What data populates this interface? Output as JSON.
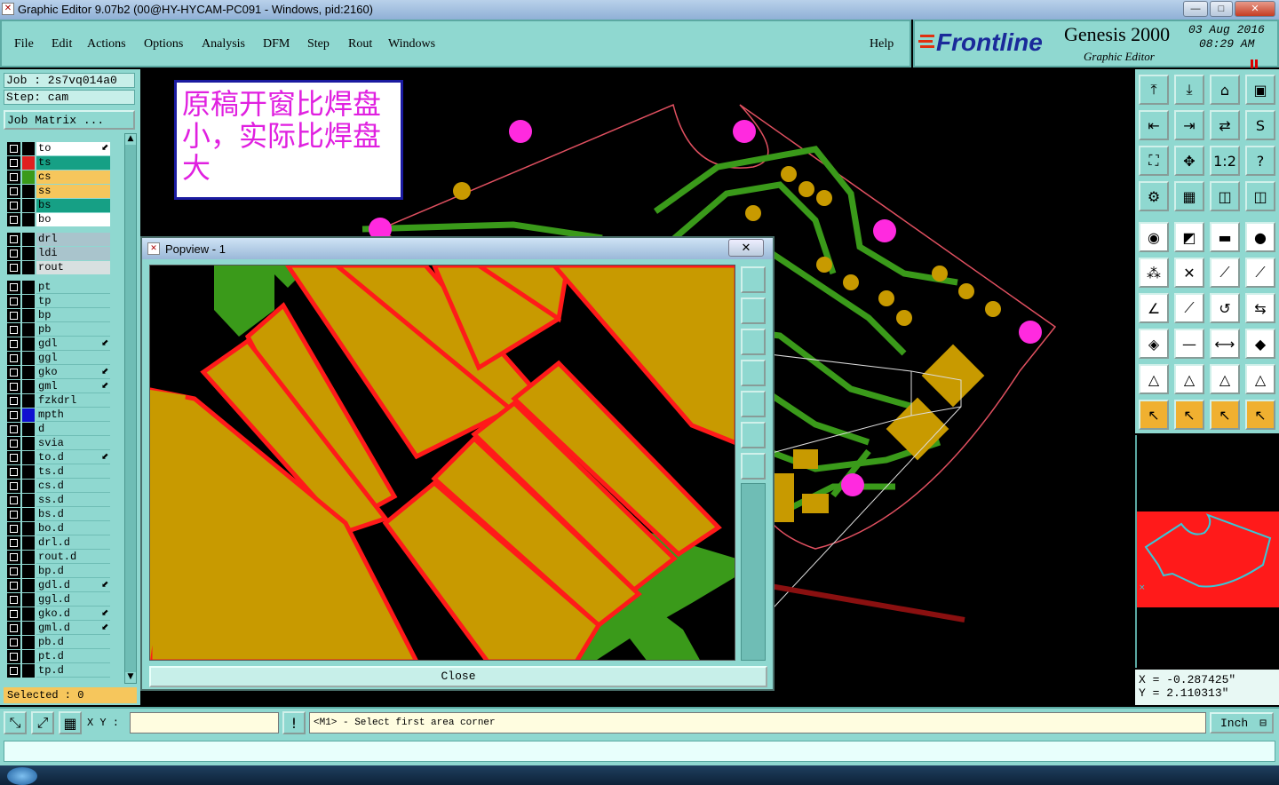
{
  "window": {
    "title": "Graphic Editor 9.07b2 (00@HY-HYCAM-PC091 - Windows, pid:2160)",
    "min_label": "—",
    "max_label": "□",
    "close_label": "✕"
  },
  "menu": {
    "items": [
      "File",
      "Edit",
      "Actions",
      "Options",
      "Analysis",
      "DFM",
      "Step",
      "Rout",
      "Windows"
    ],
    "help": "Help"
  },
  "brand": {
    "logo": "Frontline",
    "product": "Genesis 2000",
    "subtitle": "Graphic Editor",
    "date": "03 Aug 2016",
    "time": "08:29 AM"
  },
  "job": {
    "job_line": "Job : 2s7vq014a0",
    "step_line": "Step: cam",
    "matrix_button": "Job Matrix ..."
  },
  "layers": [
    {
      "name": "to",
      "color": "#ffffff",
      "marker": "#000000",
      "arrow": true
    },
    {
      "name": "ts",
      "color": "#16a085",
      "marker": "#e02020",
      "arrow": false
    },
    {
      "name": "cs",
      "color": "#f6c65c",
      "marker": "#3a9a1a",
      "arrow": false
    },
    {
      "name": "ss",
      "color": "#f6c65c",
      "marker": "#000000",
      "arrow": false
    },
    {
      "name": "bs",
      "color": "#16a085",
      "marker": "#000000",
      "arrow": false
    },
    {
      "name": "bo",
      "color": "#ffffff",
      "marker": "#000000",
      "arrow": false
    },
    {
      "name": "drl",
      "color": "#a9c4cc",
      "marker": "#000000",
      "arrow": false
    },
    {
      "name": "ldi",
      "color": "#a9c4cc",
      "marker": "#000000",
      "arrow": false
    },
    {
      "name": "rout",
      "color": "#d8e0e0",
      "marker": "#000000",
      "arrow": false
    },
    {
      "name": "pt",
      "color": "",
      "marker": "#000000",
      "arrow": false
    },
    {
      "name": "tp",
      "color": "",
      "marker": "#000000",
      "arrow": false
    },
    {
      "name": "bp",
      "color": "",
      "marker": "#000000",
      "arrow": false
    },
    {
      "name": "pb",
      "color": "",
      "marker": "#000000",
      "arrow": false
    },
    {
      "name": "gdl",
      "color": "",
      "marker": "#000000",
      "arrow": true
    },
    {
      "name": "ggl",
      "color": "",
      "marker": "#000000",
      "arrow": false
    },
    {
      "name": "gko",
      "color": "",
      "marker": "#000000",
      "arrow": true
    },
    {
      "name": "gml",
      "color": "",
      "marker": "#000000",
      "arrow": true
    },
    {
      "name": "fzkdrl",
      "color": "",
      "marker": "#000000",
      "arrow": false
    },
    {
      "name": "mpth",
      "color": "",
      "marker": "#1010d0",
      "arrow": false
    },
    {
      "name": "d",
      "color": "",
      "marker": "#000000",
      "arrow": false
    },
    {
      "name": "svia",
      "color": "",
      "marker": "#000000",
      "arrow": false
    },
    {
      "name": "to.d",
      "color": "",
      "marker": "#000000",
      "arrow": true
    },
    {
      "name": "ts.d",
      "color": "",
      "marker": "#000000",
      "arrow": false
    },
    {
      "name": "cs.d",
      "color": "",
      "marker": "#000000",
      "arrow": false
    },
    {
      "name": "ss.d",
      "color": "",
      "marker": "#000000",
      "arrow": false
    },
    {
      "name": "bs.d",
      "color": "",
      "marker": "#000000",
      "arrow": false
    },
    {
      "name": "bo.d",
      "color": "",
      "marker": "#000000",
      "arrow": false
    },
    {
      "name": "drl.d",
      "color": "",
      "marker": "#000000",
      "arrow": false
    },
    {
      "name": "rout.d",
      "color": "",
      "marker": "#000000",
      "arrow": false
    },
    {
      "name": "bp.d",
      "color": "",
      "marker": "#000000",
      "arrow": false
    },
    {
      "name": "gdl.d",
      "color": "",
      "marker": "#000000",
      "arrow": true
    },
    {
      "name": "ggl.d",
      "color": "",
      "marker": "#000000",
      "arrow": false
    },
    {
      "name": "gko.d",
      "color": "",
      "marker": "#000000",
      "arrow": true
    },
    {
      "name": "gml.d",
      "color": "",
      "marker": "#000000",
      "arrow": true
    },
    {
      "name": "pb.d",
      "color": "",
      "marker": "#000000",
      "arrow": false
    },
    {
      "name": "pt.d",
      "color": "",
      "marker": "#000000",
      "arrow": false
    },
    {
      "name": "tp.d",
      "color": "",
      "marker": "#000000",
      "arrow": false
    }
  ],
  "selected": "Selected : 0",
  "annotation": "原稿开窗比焊盘小，实际比焊盘大",
  "popview": {
    "title": "Popview - 1",
    "close_label": "Close",
    "close_x": "✕"
  },
  "coords": {
    "x": "X = -0.287425\"",
    "y": "Y = 2.110313\""
  },
  "command": {
    "xy_label": "X Y :",
    "input_value": "",
    "prompt": "<M1> - Select first area corner",
    "units": "Inch"
  },
  "colors": {
    "panel": "#8fd8d0",
    "copper_pad": "#c89a00",
    "trace": "#3a9a1a",
    "mask_outline": "#ff1a1a",
    "drill": "#ff2adf"
  }
}
